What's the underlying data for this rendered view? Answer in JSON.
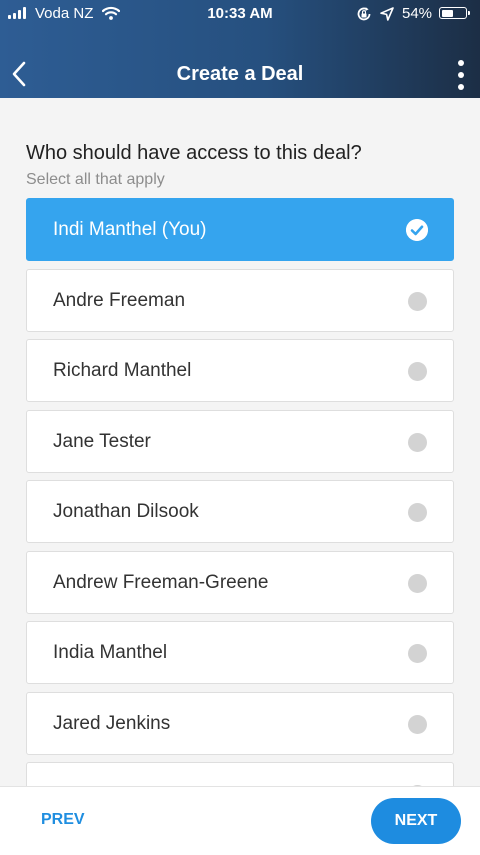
{
  "status_bar": {
    "carrier": "Voda NZ",
    "time": "10:33 AM",
    "battery_percent": "54%",
    "battery_level": 0.54,
    "icons": [
      "signal-icon",
      "wifi-icon",
      "orientation-lock-icon",
      "location-icon",
      "battery-icon"
    ]
  },
  "nav": {
    "title": "Create a Deal",
    "back_icon": "chevron-left-icon",
    "more_icon": "more-vertical-icon"
  },
  "question": "Who should have access to this deal?",
  "hint": "Select all that apply",
  "options": [
    {
      "label": "Indi Manthel (You)",
      "selected": true
    },
    {
      "label": "Andre Freeman",
      "selected": false
    },
    {
      "label": "Richard Manthel",
      "selected": false
    },
    {
      "label": "Jane Tester",
      "selected": false
    },
    {
      "label": "Jonathan Dilsook",
      "selected": false
    },
    {
      "label": "Andrew Freeman-Greene",
      "selected": false
    },
    {
      "label": "India Manthel",
      "selected": false
    },
    {
      "label": "Jared Jenkins",
      "selected": false
    },
    {
      "label": "",
      "selected": false
    }
  ],
  "footer": {
    "prev_label": "PREV",
    "next_label": "NEXT"
  },
  "colors": {
    "accent": "#35a4ee",
    "button": "#1e8ce0",
    "header_start": "#2e5d94",
    "header_end": "#1c2e45"
  }
}
